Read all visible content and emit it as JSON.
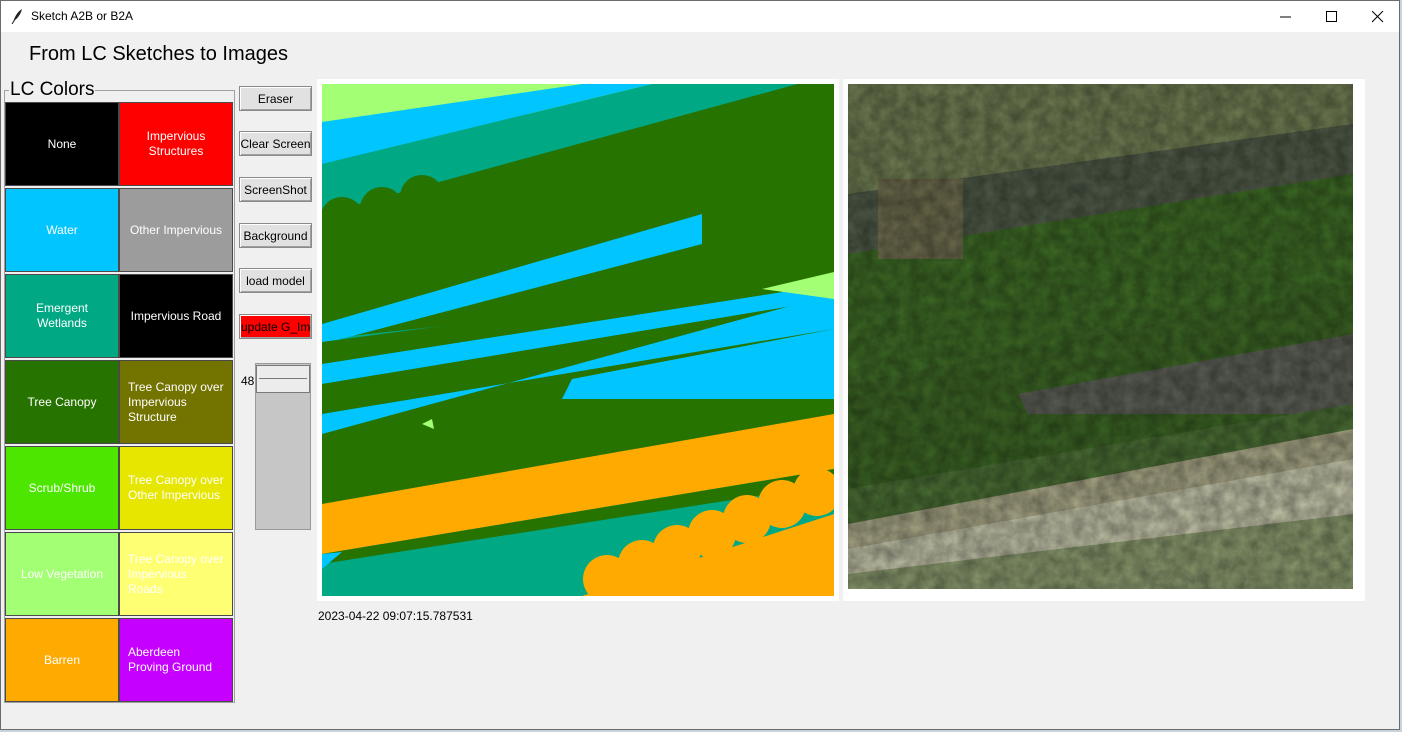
{
  "window": {
    "title": "Sketch A2B or B2A",
    "controls": [
      "minimize",
      "maximize",
      "close"
    ]
  },
  "heading": "From LC Sketches to Images",
  "lc_colors": {
    "legend": "LC Colors",
    "items": [
      {
        "label": "None",
        "color": "#000000",
        "text_color": "#ffffff"
      },
      {
        "label": "Impervious Structures",
        "color": "#ff0000",
        "text_color": "#ffffff"
      },
      {
        "label": "Water",
        "color": "#00c5ff",
        "text_color": "#ffffff"
      },
      {
        "label": "Other Impervious",
        "color": "#9c9c9c",
        "text_color": "#ffffff"
      },
      {
        "label": "Emergent Wetlands",
        "color": "#00a884",
        "text_color": "#ffffff"
      },
      {
        "label": "Impervious Road",
        "color": "#000000",
        "text_color": "#ffffff"
      },
      {
        "label": "Tree Canopy",
        "color": "#267300",
        "text_color": "#ffffff"
      },
      {
        "label": "Tree Canopy over Impervious Structure",
        "color": "#737300",
        "text_color": "#ffffff"
      },
      {
        "label": "Scrub/Shrub",
        "color": "#4ce600",
        "text_color": "#ffffff"
      },
      {
        "label": "Tree Canopy over Other Impervious",
        "color": "#e6e600",
        "text_color": "#ffffff"
      },
      {
        "label": "Low Vegetation",
        "color": "#a3ff73",
        "text_color": "#ffffff"
      },
      {
        "label": "Tree Canopy over Impervious Roads",
        "color": "#ffff73",
        "text_color": "#ffffff"
      },
      {
        "label": "Barren",
        "color": "#ffaa00",
        "text_color": "#ffffff"
      },
      {
        "label": "Aberdeen Proving Ground",
        "color": "#c500ff",
        "text_color": "#ffffff"
      }
    ]
  },
  "toolbar": {
    "eraser": "Eraser",
    "clear_screen": "Clear Screen",
    "screenshot": "ScreenShot",
    "background": "Background",
    "load_model": "load model",
    "update": "update G_Img"
  },
  "brush": {
    "value": "48",
    "level": 0.48
  },
  "timestamp": "2023-04-22 09:07:15.787531"
}
